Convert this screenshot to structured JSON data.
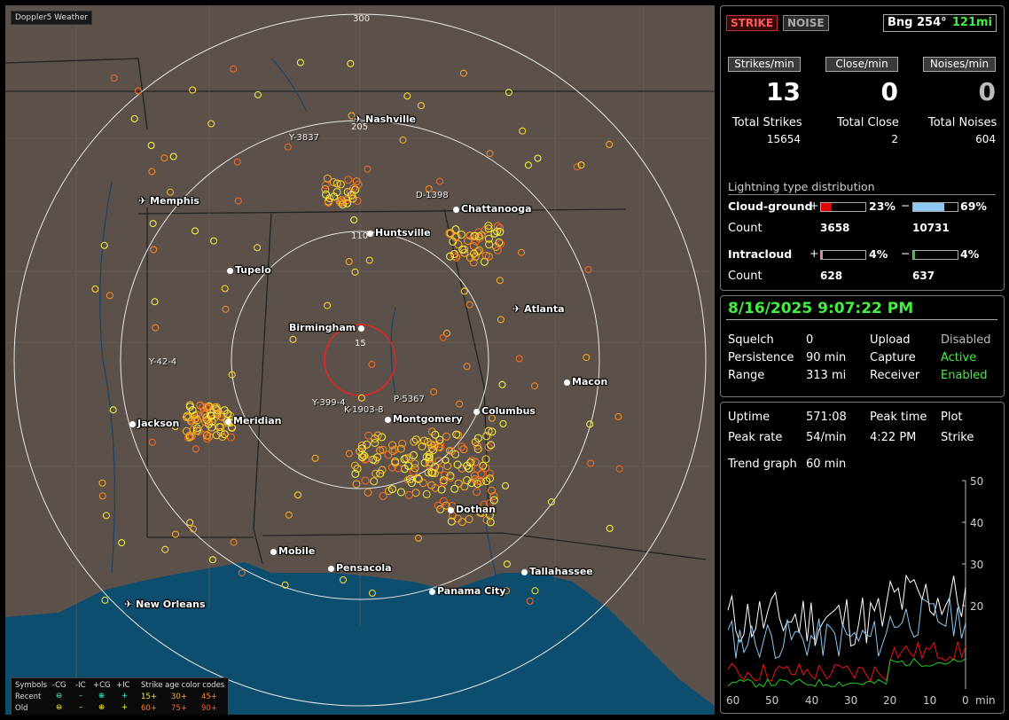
{
  "app": {
    "title": "Doppler5 Weather"
  },
  "map": {
    "range_rings": [
      "300",
      "205",
      "110",
      "15"
    ],
    "cities": [
      {
        "name": "Nashville",
        "icon": "airport-icon"
      },
      {
        "name": "Memphis",
        "icon": "airport-icon"
      },
      {
        "name": "Chattanooga",
        "icon": "city-dot"
      },
      {
        "name": "Huntsville",
        "icon": "city-dot"
      },
      {
        "name": "Tupelo",
        "icon": "city-dot"
      },
      {
        "name": "Atlanta",
        "icon": "airport-icon"
      },
      {
        "name": "Birmingham",
        "icon": "city-dot"
      },
      {
        "name": "Macon",
        "icon": "city-dot"
      },
      {
        "name": "Jackson",
        "icon": "city-dot"
      },
      {
        "name": "Meridian",
        "icon": "city-dot"
      },
      {
        "name": "Montgomery",
        "icon": "city-dot"
      },
      {
        "name": "Columbus",
        "icon": "city-dot"
      },
      {
        "name": "Dothan",
        "icon": "city-dot"
      },
      {
        "name": "Mobile",
        "icon": "city-dot"
      },
      {
        "name": "Pensacola",
        "icon": "city-dot"
      },
      {
        "name": "Tallahassee",
        "icon": "city-dot"
      },
      {
        "name": "Panama City",
        "icon": "city-dot"
      },
      {
        "name": "New Orleans",
        "icon": "airport-icon"
      }
    ],
    "storm_labels": [
      "Y-3837",
      "D-1398",
      "Y-42-4",
      "Y-399-4",
      "K-1903-8",
      "P-5367"
    ],
    "legend": {
      "symbols_label": "Symbols",
      "cols": [
        "-CG",
        "-IC",
        "+CG",
        "+IC"
      ],
      "recent_label": "Recent",
      "old_label": "Old",
      "age_title": "Strike age color codes",
      "recent_ages": [
        "15+",
        "30+",
        "45+"
      ],
      "old_ages": [
        "60+",
        "75+",
        "90+"
      ]
    }
  },
  "stats": {
    "strike_button": "STRIKE",
    "noise_button": "NOISE",
    "bearing": "Bng 254°",
    "distance": "121mi",
    "strikes_per_min_label": "Strikes/min",
    "close_per_min_label": "Close/min",
    "noises_per_min_label": "Noises/min",
    "strikes_per_min": "13",
    "close_per_min": "0",
    "noises_per_min": "0",
    "total_strikes_label": "Total Strikes",
    "total_close_label": "Total Close",
    "total_noises_label": "Total Noises",
    "total_strikes": "15654",
    "total_close": "2",
    "total_noises": "604"
  },
  "distribution": {
    "title": "Lightning type distribution",
    "cg_label": "Cloud-ground",
    "ic_label": "Intracloud",
    "count_label": "Count",
    "cg_pos_pct": "23%",
    "cg_neg_pct": "69%",
    "cg_pos_count": "3658",
    "cg_neg_count": "10731",
    "ic_pos_pct": "4%",
    "ic_neg_pct": "4%",
    "ic_pos_count": "628",
    "ic_neg_count": "637",
    "cg_pos_fill": 0.23,
    "cg_neg_fill": 0.69,
    "ic_pos_fill": 0.04,
    "ic_neg_fill": 0.04,
    "colors": {
      "cg_pos": "#e00000",
      "cg_neg": "#8ec8f0",
      "ic_pos": "#e080b0",
      "ic_neg": "#30c030"
    }
  },
  "status": {
    "datetime": "8/16/2025 9:07:22 PM",
    "squelch_label": "Squelch",
    "squelch": "0",
    "persistence_label": "Persistence",
    "persistence": "90 min",
    "range_label": "Range",
    "range": "313 mi",
    "upload_label": "Upload",
    "upload": "Disabled",
    "capture_label": "Capture",
    "capture": "Active",
    "receiver_label": "Receiver",
    "receiver": "Enabled"
  },
  "trend": {
    "uptime_label": "Uptime",
    "uptime": "571:08",
    "peak_time_label": "Peak time",
    "peak_time": "4:22 PM",
    "plot_label": "Plot",
    "plot": "Strike",
    "peak_rate_label": "Peak rate",
    "peak_rate": "54/min",
    "trend_graph_label": "Trend graph",
    "trend_graph": "60 min",
    "y_ticks": [
      "50",
      "40",
      "30",
      "20"
    ],
    "x_ticks": [
      "60",
      "50",
      "40",
      "30",
      "20",
      "10",
      "0"
    ],
    "x_unit": "min"
  }
}
